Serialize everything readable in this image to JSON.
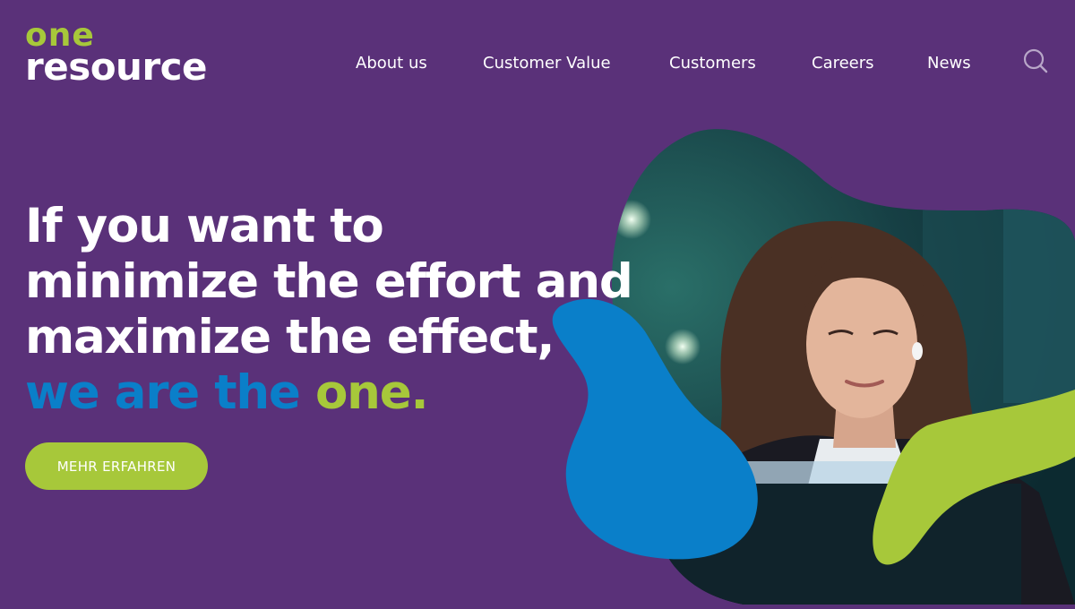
{
  "brand": {
    "logo_top": "one",
    "logo_bottom": "resource"
  },
  "nav": {
    "items": [
      {
        "label": "About us"
      },
      {
        "label": "Customer Value"
      },
      {
        "label": "Customers"
      },
      {
        "label": "Careers"
      },
      {
        "label": "News"
      }
    ],
    "search_icon": "search-icon"
  },
  "hero": {
    "headline_lines": [
      "If you want to",
      "minimize the effort and",
      "maximize the effect,"
    ],
    "tagline_part1": "we are the",
    "tagline_part2": "one.",
    "cta_label": "MEHR ERFAHREN"
  },
  "colors": {
    "background": "#5a3179",
    "brand_green": "#a7c83a",
    "brand_blue": "#0a7fc9",
    "text": "#ffffff"
  }
}
